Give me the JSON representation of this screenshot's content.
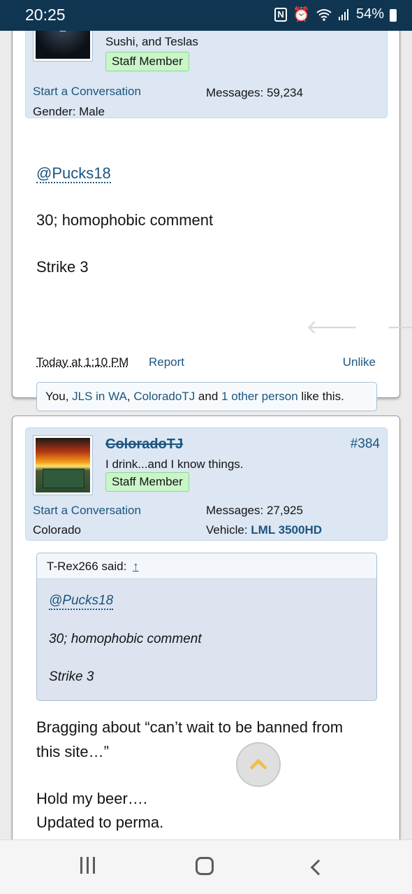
{
  "status_bar": {
    "time": "20:25",
    "battery": "54%"
  },
  "post1": {
    "user_title": "Sushi, and Teslas",
    "badge": "Staff Member",
    "start_conversation": "Start a Conversation",
    "gender": "Gender:  Male",
    "messages_label": "Messages:",
    "messages_value": "59,234",
    "mention": "@Pucks18",
    "line1": "30; homophobic comment",
    "line2": "Strike 3",
    "date": "Today at 1:10 PM",
    "report": "Report",
    "unlike": "Unlike",
    "likes": {
      "you": "You, ",
      "user1": "JLS in WA",
      "comma": ", ",
      "user2": "ColoradoTJ",
      "and": " and ",
      "other": "1 other person",
      "suffix": " like this."
    }
  },
  "post2": {
    "username": "ColoradoTJ",
    "post_number": "#384",
    "user_title": "I drink...and I know things.",
    "badge": "Staff Member",
    "start_conversation": "Start a Conversation",
    "location": "Colorado",
    "messages_label": "Messages:",
    "messages_value": "27,925",
    "vehicle_label": "Vehicle:",
    "vehicle_value": "LML 3500HD",
    "quote": {
      "author": "T-Rex266 said:",
      "up_arrow": "↑",
      "mention": "@Pucks18",
      "line1": "30; homophobic comment",
      "line2": "Strike 3"
    },
    "body_line1": "Bragging about “can’t wait to be banned from",
    "body_line2": "this site…”",
    "body_line3": "Hold my beer….",
    "body_line4": "Updated to perma."
  },
  "icons": {
    "nav_left": "arrow-left-icon",
    "nav_right": "arrow-right-icon",
    "scroll_top": "chevron-up-icon"
  }
}
